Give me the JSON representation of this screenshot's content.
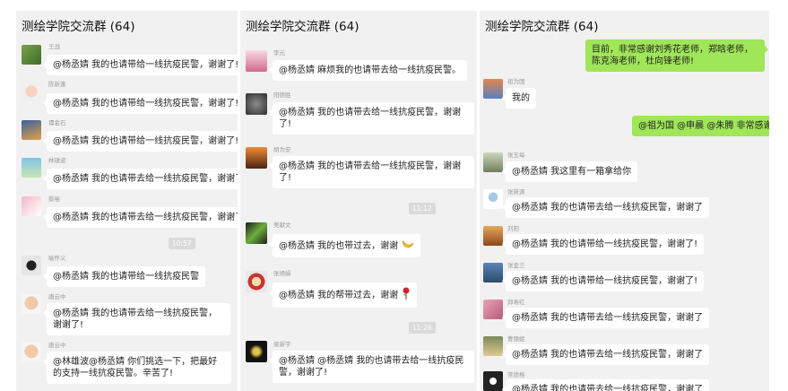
{
  "panels": [
    {
      "title": "测绘学院交流群 (64)"
    },
    {
      "title": "测绘学院交流群 (64)"
    },
    {
      "title": "测绘学院交流群 (64)"
    }
  ],
  "p1": {
    "m1": {
      "name": "王战",
      "text": "@杨丞婧 我的也请带给一线抗疫民警，谢谢了!"
    },
    "m2": {
      "name": "陈新蓬",
      "text": "@杨丞婧 我的也请带给一线抗疫民警，谢谢了!"
    },
    "m3": {
      "name": "谭金石",
      "text": "@杨丞婧 我的也请带给一线抗疫民警，谢谢了!"
    },
    "m4": {
      "name": "林雄波",
      "text": "@杨丞婧 我的也请带去给一线抗疫民警，谢谢了"
    },
    "m5": {
      "name": "蔡裕",
      "text": "@杨丞婧 我的也请带去给一线抗疫民警，谢谢了"
    },
    "time": "10:57",
    "m6": {
      "name": "喻怀义",
      "text": "@杨丞婧 我的也请带给一线抗疫民警"
    },
    "m7": {
      "name": "唐云中",
      "text": "@杨丞婧 我的也请带去给一线抗疫民警，谢谢了!"
    },
    "m8": {
      "name": "唐云中",
      "text": "@林雄波@杨丞婧 你们挑选一下，把最好的支持一线抗疫民警。辛苦了!"
    }
  },
  "p2": {
    "m1": {
      "name": "李元",
      "text": "@杨丞婧 麻烦我的也请带去给一线抗疫民警。"
    },
    "m2": {
      "name": "阳德胜",
      "text": "@杨丞婧 我的也请带去给一线抗疫民警，谢谢了!"
    },
    "m3": {
      "name": "胡为安",
      "text": "@杨丞婧 我的也请带去给一线抗疫民警，谢谢了!"
    },
    "time1": "11:12",
    "m4": {
      "name": "吴献文",
      "text": "@杨丞婧 我的也带过去，谢谢"
    },
    "m5": {
      "name": "张炳娟",
      "text": "@杨丞婧 我的帮带过去，谢谢"
    },
    "time2": "11:26",
    "m6": {
      "name": "梁新宇",
      "text": "@杨丞婧 @杨丞婧 我的也请带去给一线抗疫民警，谢谢了!"
    }
  },
  "p3": {
    "s1": {
      "text": "目前，非常感谢刘秀花老师，郑晗老师，陈克海老师，杜向锋老师!"
    },
    "m1": {
      "name": "祖为国",
      "text": "我的"
    },
    "s2": {
      "text": "@祖为国 @申晨 @朱腾 非常感谢!"
    },
    "m2": {
      "name": "张玉每",
      "text": "@杨丞婧 我这里有一箱拿给你"
    },
    "m3": {
      "name": "张新源",
      "text": "@杨丞婧 我的也请带去给一线抗疫民警，谢谢了"
    },
    "m4": {
      "name": "刘阳",
      "text": "@杨丞婧 我的也请带给一线抗疫民警，谢谢了!"
    },
    "m5": {
      "name": "张金兰",
      "text": "@杨丞婧 我的也请带给一线抗疫民警，谢谢了!"
    },
    "m6": {
      "name": "邱寿红",
      "text": "@杨丞婧 我的也请带去给一线抗疫民警，谢谢了"
    },
    "m7": {
      "name": "曹丽妮",
      "text": "@杨丞婧 我的也请带去给一线抗疫民警，谢谢了"
    },
    "m8": {
      "name": "常德格",
      "text": "@杨丞婧 我的也请带去给一线抗疫民警，谢谢了"
    }
  },
  "colors": {
    "panel_bg": "#f1f1f1",
    "bubble_self": "#9fe658",
    "bubble_other": "#ffffff"
  }
}
